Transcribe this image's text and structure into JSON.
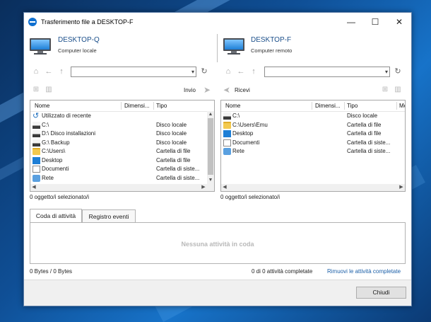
{
  "window": {
    "title": "Trasferimento file a DESKTOP-F",
    "minimize_glyph": "—",
    "maximize_glyph": "☐",
    "close_glyph": "✕"
  },
  "local": {
    "name": "DESKTOP-Q",
    "subtitle": "Computer locale",
    "action_label": "Invio",
    "selection_status": "0 oggetto/i selezionato/i",
    "columns": [
      "Nome",
      "Dimensi...",
      "Tipo"
    ],
    "rows": [
      {
        "icon": "recent-icon",
        "name": "Utilizzato di recente",
        "type": ""
      },
      {
        "icon": "drive-icon",
        "name": "C:\\",
        "type": "Disco locale"
      },
      {
        "icon": "drive-icon",
        "name": "D:\\  Disco installazioni",
        "type": "Disco locale"
      },
      {
        "icon": "drive-icon",
        "name": "G:\\  Backup",
        "type": "Disco locale"
      },
      {
        "icon": "folder-icon",
        "name": "C:\\Users\\",
        "type": "Cartella di file"
      },
      {
        "icon": "desktop-icon",
        "name": "Desktop",
        "type": "Cartella di file"
      },
      {
        "icon": "documents-icon",
        "name": "Documenti",
        "type": "Cartella di siste..."
      },
      {
        "icon": "network-icon",
        "name": "Rete",
        "type": "Cartella di siste..."
      }
    ]
  },
  "remote": {
    "name": "DESKTOP-F",
    "subtitle": "Computer remoto",
    "action_label": "Ricevi",
    "selection_status": "0 oggetto/i selezionato/i",
    "columns": [
      "Nome",
      "Dimensi...",
      "Tipo",
      "Mo"
    ],
    "rows": [
      {
        "icon": "drive-icon",
        "name": "C:\\",
        "type": "Disco locale"
      },
      {
        "icon": "folder-icon",
        "name": "C:\\Users\\Emu",
        "type": "Cartella di file"
      },
      {
        "icon": "desktop-icon",
        "name": "Desktop",
        "type": "Cartella di file"
      },
      {
        "icon": "documents-icon",
        "name": "Documenti",
        "type": "Cartella di siste..."
      },
      {
        "icon": "network-icon",
        "name": "Rete",
        "type": "Cartella di siste..."
      }
    ]
  },
  "tabs": [
    {
      "label": "Coda di attività",
      "active": true
    },
    {
      "label": "Registro eventi",
      "active": false
    }
  ],
  "queue": {
    "empty_text": "Nessuna attività in coda",
    "bytes_status": "0 Bytes / 0 Bytes",
    "completed_status": "0 di 0 attività completate",
    "remove_link": "Rimuovi le attività completate"
  },
  "footer": {
    "close_label": "Chiudi"
  },
  "colors": {
    "accent": "#1b5fa8",
    "computer_name": "#1b4f8a"
  }
}
